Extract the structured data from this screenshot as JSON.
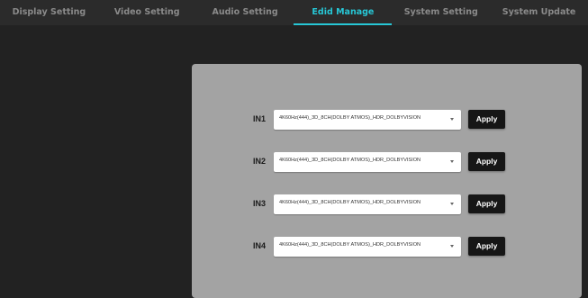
{
  "nav": {
    "tabs": [
      {
        "label": "Display Setting"
      },
      {
        "label": "Video Setting"
      },
      {
        "label": "Audio Setting"
      },
      {
        "label": "Edid Manage"
      },
      {
        "label": "System Setting"
      },
      {
        "label": "System Update"
      }
    ],
    "active_tab": "Edid Manage",
    "accent_color": "#27c7d6"
  },
  "edid": {
    "inputs": [
      {
        "label": "IN1",
        "value": "4K60Hz(444)_3D_8CH(DOLBY ATMOS)_HDR_DOLBYVISION",
        "apply_label": "Apply"
      },
      {
        "label": "IN2",
        "value": "4K60Hz(444)_3D_8CH(DOLBY ATMOS)_HDR_DOLBYVISION",
        "apply_label": "Apply"
      },
      {
        "label": "IN3",
        "value": "4K60Hz(444)_3D_8CH(DOLBY ATMOS)_HDR_DOLBYVISION",
        "apply_label": "Apply"
      },
      {
        "label": "IN4",
        "value": "4K60Hz(444)_3D_8CH(DOLBY ATMOS)_HDR_DOLBYVISION",
        "apply_label": "Apply"
      }
    ],
    "dropdown_icon": "chevron-down-icon"
  }
}
